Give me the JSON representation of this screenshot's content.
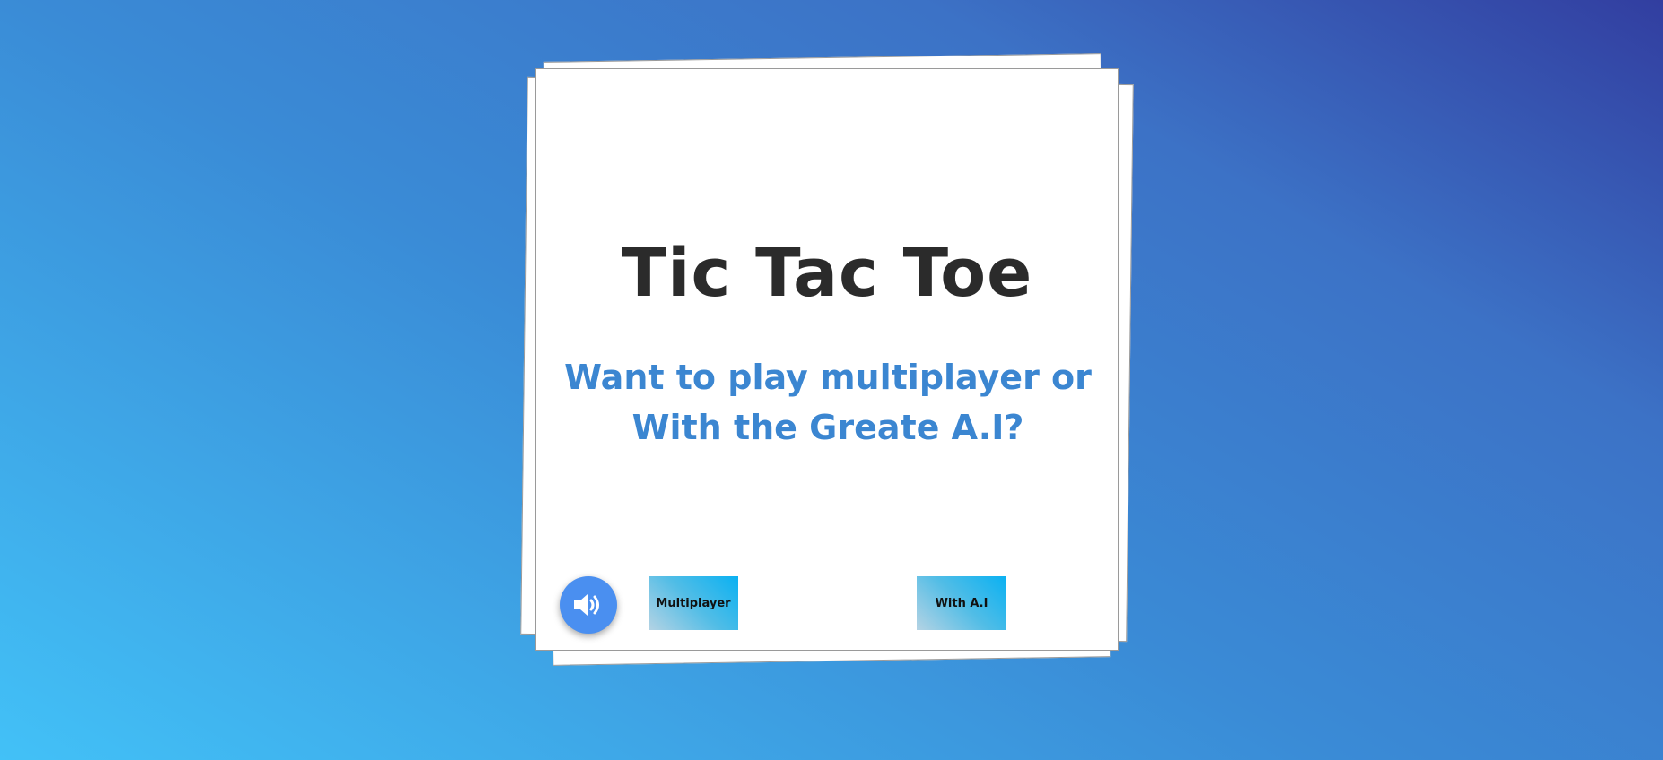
{
  "game": {
    "title": "Tic Tac Toe",
    "question": "Want to play multiplayer or With the Greate A.I?"
  },
  "controls": {
    "sound_icon": "speaker-volume-icon",
    "multiplayer_label": "Multiplayer",
    "ai_label": "With A.I"
  },
  "colors": {
    "title": "#2b2b2b",
    "question": "#3b86d1",
    "sound_button": "#4a8ff0",
    "button_gradient_start": "#0ab1f2",
    "button_gradient_end": "#b5d3e4",
    "background_start": "#42c1f7",
    "background_end": "#323ea0"
  }
}
